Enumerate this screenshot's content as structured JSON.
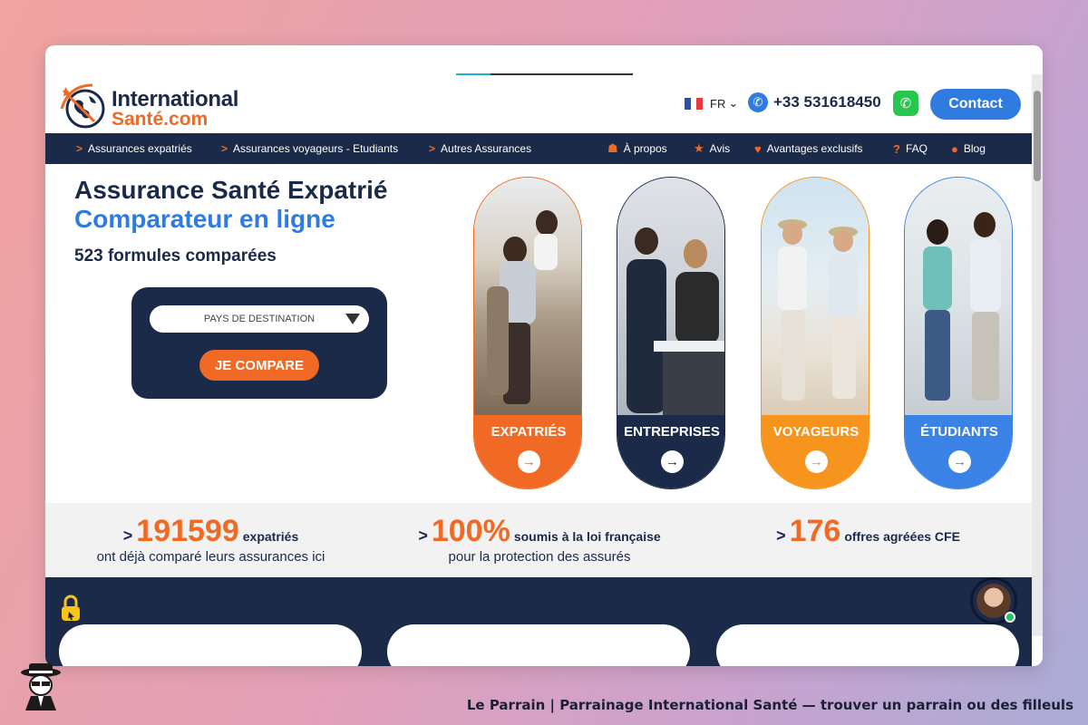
{
  "header": {
    "logo_line1": "International",
    "logo_line2": "Santé.com",
    "lang": "FR",
    "phone": "+33 531618450",
    "contact_label": "Contact"
  },
  "nav": {
    "left": [
      {
        "label": "Assurances expatriés"
      },
      {
        "label": "Assurances voyageurs - Etudiants"
      },
      {
        "label": "Autres Assurances"
      }
    ],
    "right": [
      {
        "label": "À propos",
        "icon": "team-icon"
      },
      {
        "label": "Avis",
        "icon": "star-icon"
      },
      {
        "label": "Avantages exclusifs",
        "icon": "heart-icon"
      },
      {
        "label": "FAQ",
        "icon": "question-icon"
      },
      {
        "label": "Blog",
        "icon": "chat-bubble-icon"
      }
    ]
  },
  "hero": {
    "title1": "Assurance Santé Expatrié",
    "title2": "Comparateur en ligne",
    "subtitle": "523 formules comparées",
    "destination_placeholder": "PAYS DE DESTINATION",
    "compare_label": "JE COMPARE"
  },
  "cards": [
    {
      "label": "EXPATRIÉS",
      "color": "#f06a25"
    },
    {
      "label": "ENTREPRISES",
      "color": "#1b2a49"
    },
    {
      "label": "VOYAGEURS",
      "color": "#f7941d"
    },
    {
      "label": "ÉTUDIANTS",
      "color": "#3b82e6"
    }
  ],
  "stats": [
    {
      "gt": ">",
      "number": "191599",
      "text": "expatriés",
      "line2": "ont déjà comparé leurs assurances ici"
    },
    {
      "gt": ">",
      "number": "100%",
      "text": "soumis à la loi française",
      "line2": "pour la protection des assurés"
    },
    {
      "gt": ">",
      "number": "176",
      "text": "offres agréées CFE",
      "line2": ""
    }
  ],
  "caption": "Le Parrain | Parrainage International Santé — trouver un parrain ou des filleuls",
  "colors": {
    "navy": "#1b2a49",
    "orange": "#f06a25",
    "blue": "#2f7be0"
  }
}
